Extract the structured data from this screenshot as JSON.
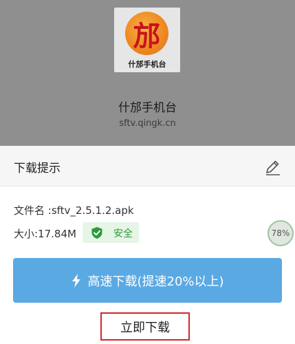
{
  "app": {
    "logo_caption": "什邡手机台",
    "name": "什邡手机台",
    "domain": "sftv.qingk.cn",
    "logo_glyph": "邡"
  },
  "sheet": {
    "title": "下载提示",
    "file_name": "文件名 :sftv_2.5.1.2.apk",
    "file_size": "大小:17.84M",
    "safe_label": "安全",
    "progress_label": "78%",
    "fast_download_label": "高速下载(提速20%以上)",
    "download_now_label": "立即下载"
  },
  "icons": {
    "edit": "pencil-icon",
    "shield": "shield-check-icon",
    "bolt": "lightning-icon"
  },
  "colors": {
    "primary_button": "#5ba9e3",
    "safe_green": "#2a9a3a",
    "highlight_border": "#d3262a"
  }
}
